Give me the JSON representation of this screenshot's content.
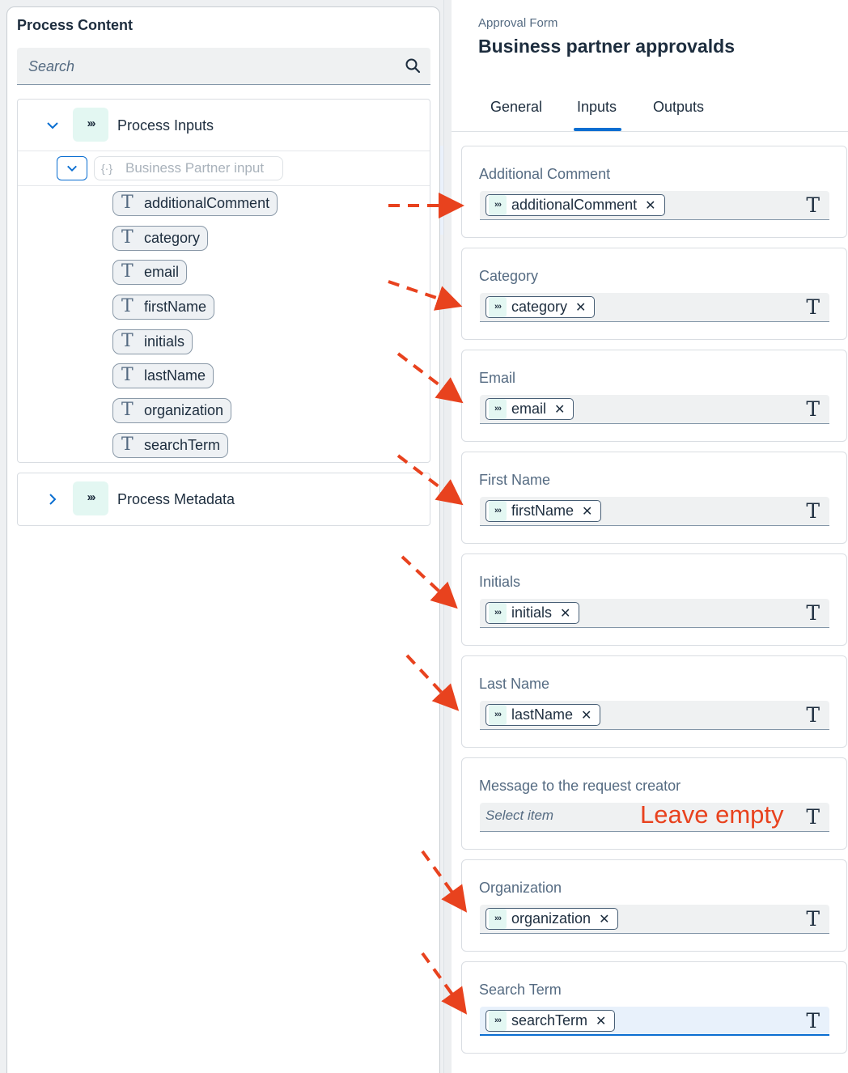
{
  "left_panel": {
    "title": "Process Content",
    "search_placeholder": "Search",
    "process_inputs_label": "Process Inputs",
    "business_partner_input_label": "Business Partner input",
    "fields": [
      "additionalComment",
      "category",
      "email",
      "firstName",
      "initials",
      "lastName",
      "organization",
      "searchTerm"
    ],
    "process_metadata_label": "Process Metadata"
  },
  "right_panel": {
    "subtitle": "Approval Form",
    "title": "Business partner approvalds",
    "tabs": [
      "General",
      "Inputs",
      "Outputs"
    ],
    "active_tab": "Inputs",
    "cards": [
      {
        "label": "Additional Comment",
        "value": "additionalComment"
      },
      {
        "label": "Category",
        "value": "category"
      },
      {
        "label": "Email",
        "value": "email"
      },
      {
        "label": "First Name",
        "value": "firstName"
      },
      {
        "label": "Initials",
        "value": "initials"
      },
      {
        "label": "Last Name",
        "value": "lastName"
      },
      {
        "label": "Message to the request creator",
        "value": null,
        "placeholder": "Select item",
        "annotation": "Leave empty"
      },
      {
        "label": "Organization",
        "value": "organization"
      },
      {
        "label": "Search Term",
        "value": "searchTerm"
      }
    ]
  },
  "colors": {
    "accent": "#0a6ed1",
    "annotation": "#e8421e",
    "process_icon_bg": "#e3f7f2"
  }
}
